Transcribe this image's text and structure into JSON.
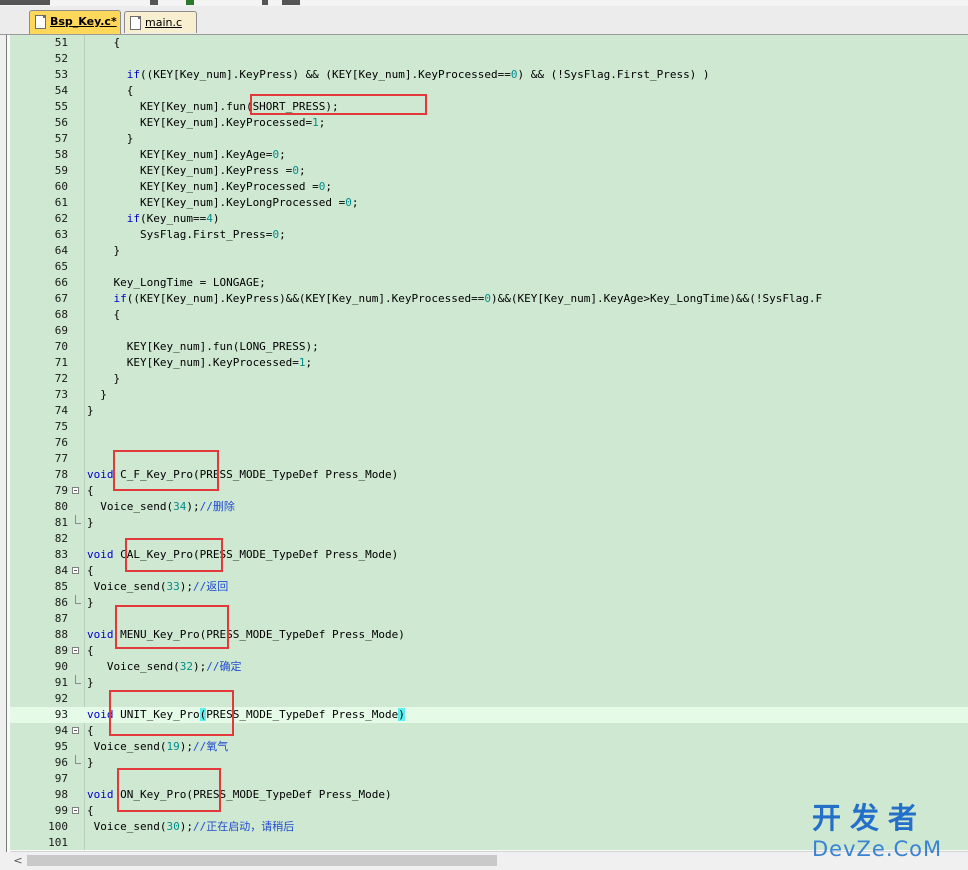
{
  "tabs": [
    {
      "label": "Bsp_Key.c*",
      "active": true
    },
    {
      "label": "main.c",
      "active": false
    }
  ],
  "current_line": 93,
  "lines": [
    {
      "n": "51",
      "t": [
        [
          "    {",
          ""
        ]
      ]
    },
    {
      "n": "52",
      "t": []
    },
    {
      "n": "53",
      "t": [
        [
          "      ",
          ""
        ],
        [
          "if",
          "kw"
        ],
        [
          "((KEY[Key_num].KeyPress) && (KEY[Key_num].KeyProcessed==",
          ""
        ],
        [
          "0",
          "num"
        ],
        [
          ") && (!SysFlag.First_Press) )",
          ""
        ]
      ]
    },
    {
      "n": "54",
      "t": [
        [
          "      {",
          ""
        ]
      ]
    },
    {
      "n": "55",
      "t": [
        [
          "        KEY[Key_num].fun(SHORT_PRESS);",
          ""
        ]
      ]
    },
    {
      "n": "56",
      "t": [
        [
          "        KEY[Key_num].KeyProcessed=",
          ""
        ],
        [
          "1",
          "num"
        ],
        [
          ";",
          ""
        ]
      ]
    },
    {
      "n": "57",
      "t": [
        [
          "      }",
          ""
        ]
      ]
    },
    {
      "n": "58",
      "t": [
        [
          "        KEY[Key_num].KeyAge=",
          ""
        ],
        [
          "0",
          "num"
        ],
        [
          ";",
          ""
        ]
      ]
    },
    {
      "n": "59",
      "t": [
        [
          "        KEY[Key_num].KeyPress =",
          ""
        ],
        [
          "0",
          "num"
        ],
        [
          ";",
          ""
        ]
      ]
    },
    {
      "n": "60",
      "t": [
        [
          "        KEY[Key_num].KeyProcessed =",
          ""
        ],
        [
          "0",
          "num"
        ],
        [
          ";",
          ""
        ]
      ]
    },
    {
      "n": "61",
      "t": [
        [
          "        KEY[Key_num].KeyLongProcessed =",
          ""
        ],
        [
          "0",
          "num"
        ],
        [
          ";",
          ""
        ]
      ]
    },
    {
      "n": "62",
      "t": [
        [
          "      ",
          ""
        ],
        [
          "if",
          "kw"
        ],
        [
          "(Key_num==",
          ""
        ],
        [
          "4",
          "num"
        ],
        [
          ")",
          ""
        ]
      ]
    },
    {
      "n": "63",
      "t": [
        [
          "        SysFlag.First_Press=",
          ""
        ],
        [
          "0",
          "num"
        ],
        [
          ";",
          ""
        ]
      ]
    },
    {
      "n": "64",
      "t": [
        [
          "    }",
          ""
        ]
      ]
    },
    {
      "n": "65",
      "t": []
    },
    {
      "n": "66",
      "t": [
        [
          "    Key_LongTime = LONGAGE;",
          ""
        ]
      ]
    },
    {
      "n": "67",
      "t": [
        [
          "    ",
          ""
        ],
        [
          "if",
          "kw"
        ],
        [
          "((KEY[Key_num].KeyPress)&&(KEY[Key_num].KeyProcessed==",
          ""
        ],
        [
          "0",
          "num"
        ],
        [
          ")&&(KEY[Key_num].KeyAge>Key_LongTime)&&(!SysFlag.F",
          ""
        ]
      ]
    },
    {
      "n": "68",
      "t": [
        [
          "    {",
          ""
        ]
      ]
    },
    {
      "n": "69",
      "t": []
    },
    {
      "n": "70",
      "t": [
        [
          "      KEY[Key_num].fun(LONG_PRESS);",
          ""
        ]
      ]
    },
    {
      "n": "71",
      "t": [
        [
          "      KEY[Key_num].KeyProcessed=",
          ""
        ],
        [
          "1",
          "num"
        ],
        [
          ";",
          ""
        ]
      ]
    },
    {
      "n": "72",
      "t": [
        [
          "    }",
          ""
        ]
      ]
    },
    {
      "n": "73",
      "t": [
        [
          "  }",
          ""
        ]
      ]
    },
    {
      "n": "74",
      "t": [
        [
          "}",
          ""
        ]
      ]
    },
    {
      "n": "75",
      "t": []
    },
    {
      "n": "76",
      "t": []
    },
    {
      "n": "77",
      "t": []
    },
    {
      "n": "78",
      "t": [
        [
          "void",
          "kw"
        ],
        [
          " C_F_Key_Pro(PRESS_MODE_TypeDef Press_Mode)",
          ""
        ]
      ]
    },
    {
      "n": "79",
      "t": [
        [
          "{",
          ""
        ]
      ],
      "fold": "open"
    },
    {
      "n": "80",
      "t": [
        [
          "  Voice_send(",
          ""
        ],
        [
          "34",
          "num"
        ],
        [
          ");",
          ""
        ],
        [
          "//删除",
          "cm"
        ]
      ]
    },
    {
      "n": "81",
      "t": [
        [
          "}",
          ""
        ]
      ],
      "fold": "end"
    },
    {
      "n": "82",
      "t": []
    },
    {
      "n": "83",
      "t": [
        [
          "void",
          "kw"
        ],
        [
          " CAL_Key_Pro(PRESS_MODE_TypeDef Press_Mode)",
          ""
        ]
      ]
    },
    {
      "n": "84",
      "t": [
        [
          "{",
          ""
        ]
      ],
      "fold": "open"
    },
    {
      "n": "85",
      "t": [
        [
          " Voice_send(",
          ""
        ],
        [
          "33",
          "num"
        ],
        [
          ");",
          ""
        ],
        [
          "//返回",
          "cm"
        ]
      ]
    },
    {
      "n": "86",
      "t": [
        [
          "}",
          ""
        ]
      ],
      "fold": "end"
    },
    {
      "n": "87",
      "t": []
    },
    {
      "n": "88",
      "t": [
        [
          "void",
          "kw"
        ],
        [
          " MENU_Key_Pro(PRESS_MODE_TypeDef Press_Mode)",
          ""
        ]
      ]
    },
    {
      "n": "89",
      "t": [
        [
          "{",
          ""
        ]
      ],
      "fold": "open"
    },
    {
      "n": "90",
      "t": [
        [
          "   Voice_send(",
          ""
        ],
        [
          "32",
          "num"
        ],
        [
          ");",
          ""
        ],
        [
          "//确定",
          "cm"
        ]
      ]
    },
    {
      "n": "91",
      "t": [
        [
          "}",
          ""
        ]
      ],
      "fold": "end"
    },
    {
      "n": "92",
      "t": []
    },
    {
      "n": "93",
      "t": [
        [
          "void",
          "kw"
        ],
        [
          " UNIT_Key_Pro",
          ""
        ],
        [
          "(",
          "hl"
        ],
        [
          "PRESS_MODE_TypeDef Press_Mode",
          ""
        ],
        [
          ")",
          "hl"
        ]
      ]
    },
    {
      "n": "94",
      "t": [
        [
          "{",
          ""
        ]
      ],
      "fold": "open"
    },
    {
      "n": "95",
      "t": [
        [
          " Voice_send(",
          ""
        ],
        [
          "19",
          "num"
        ],
        [
          ");",
          ""
        ],
        [
          "//氧气",
          "cm"
        ]
      ]
    },
    {
      "n": "96",
      "t": [
        [
          "}",
          ""
        ]
      ],
      "fold": "end"
    },
    {
      "n": "97",
      "t": []
    },
    {
      "n": "98",
      "t": [
        [
          "void",
          "kw"
        ],
        [
          " ON_Key_Pro(PRESS_MODE_TypeDef Press_Mode)",
          ""
        ]
      ]
    },
    {
      "n": "99",
      "t": [
        [
          "{",
          ""
        ]
      ],
      "fold": "open"
    },
    {
      "n": "100",
      "t": [
        [
          " Voice_send(",
          ""
        ],
        [
          "30",
          "num"
        ],
        [
          ");",
          ""
        ],
        [
          "//正在启动，请稍后",
          "cm"
        ]
      ]
    },
    {
      "n": "101",
      "t": []
    }
  ],
  "scrollbar": {
    "left_arrow": "<"
  },
  "watermark": {
    "top": "开发者",
    "bottom": "DevZe.CoM"
  }
}
